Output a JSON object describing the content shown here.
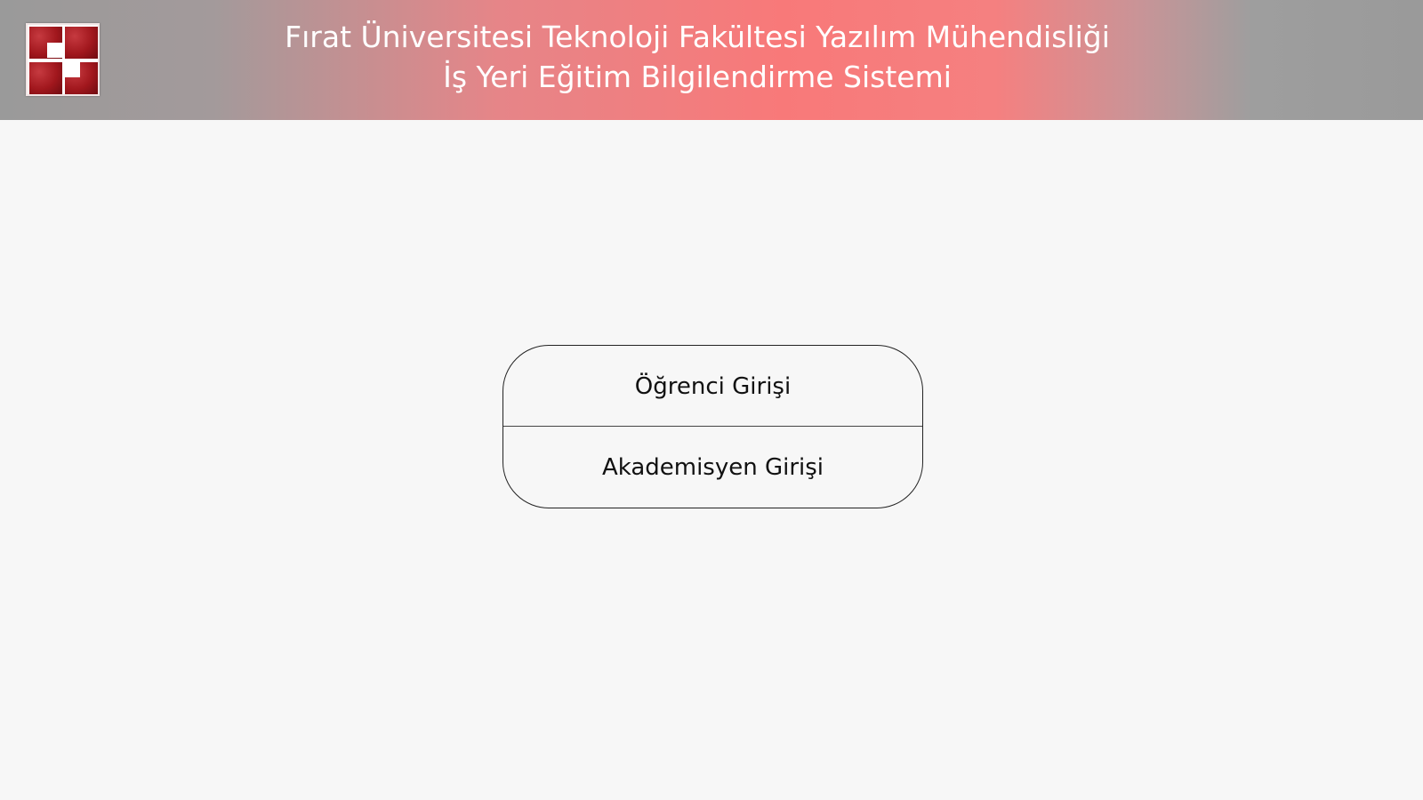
{
  "header": {
    "title_line1": "Fırat Üniversitesi Teknoloji Fakültesi Yazılım Mühendisliği",
    "title_line2": "İş Yeri Eğitim Bilgilendirme Sistemi",
    "logo_icon": "university-logo-icon",
    "logo_color": "#a1171d"
  },
  "login": {
    "student_label": "Öğrenci Girişi",
    "academic_label": "Akademisyen Girişi"
  }
}
